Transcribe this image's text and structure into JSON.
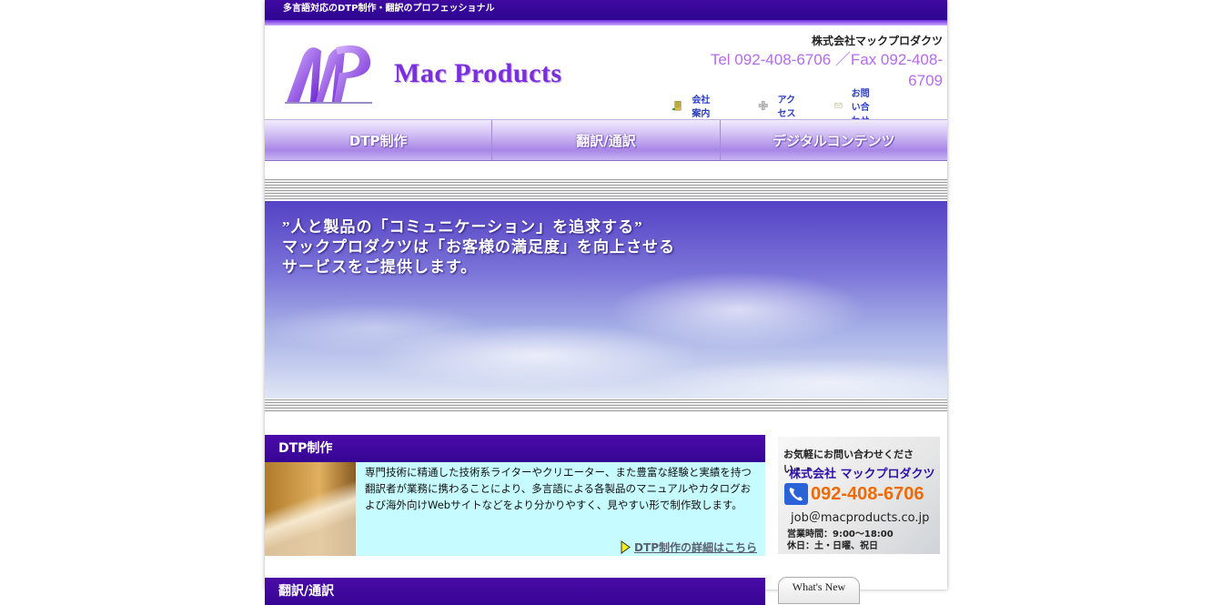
{
  "topbar": {
    "tagline": "多言語対応のDTP制作・翻訳のプロフェッショナル"
  },
  "header": {
    "logo_text": "Mac Products",
    "company_name": "株式会社マックプロダクツ",
    "tel_fax": "Tel 092-408-6706 ／Fax 092-408-6709",
    "utility_links": [
      {
        "label": "会社案内",
        "icon": "building-icon"
      },
      {
        "label": "アクセス",
        "icon": "map-pin-icon"
      },
      {
        "label": "お問い合わせ",
        "icon": "envelope-icon"
      }
    ]
  },
  "nav": {
    "items": [
      {
        "label": "DTP制作"
      },
      {
        "label": "翻訳/通訳"
      },
      {
        "label": "デジタルコンテンツ"
      }
    ]
  },
  "hero": {
    "line1": "”人と製品の「コミュニケーション」を追求する”",
    "line2": "マックプロダクツは「お客様の満足度」を向上させる",
    "line3": "サービスをご提供します。"
  },
  "dtp_section": {
    "title": "DTP制作",
    "body": "専門技術に精通した技術系ライターやクリエーター、また豊富な経験と実績を持つ翻訳者が業務に携わることにより、多言語による各製品のマニュアルやカタログおよび海外向けWebサイトなどをより分かりやすく、見やすい形で制作致します。",
    "link": "DTP制作の詳細はこちら"
  },
  "translation_section": {
    "title": "翻訳/通訳"
  },
  "contact_box": {
    "line1": "お気軽にお問い合わせください・・",
    "company": "株式会社 マックプロダクツ",
    "phone": "092-408-6706",
    "email": "job＠macproducts.co.jp",
    "hours": "営業時間：9:00～18:00",
    "holidays": "休日：土・日曜、祝日"
  },
  "whats_new": {
    "label": "What's New"
  },
  "colors": {
    "brand_purple": "#3f0aa0",
    "accent_violet": "#b56bef",
    "section_bg": "#c6fcff",
    "phone_orange": "#f06a00"
  }
}
